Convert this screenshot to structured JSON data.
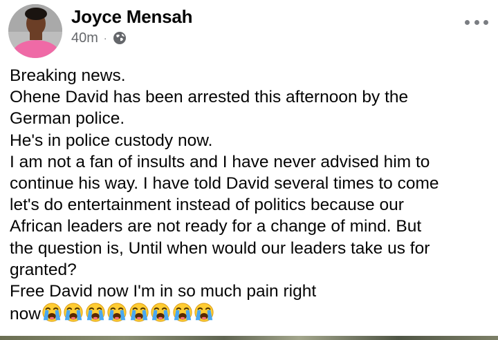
{
  "post": {
    "author": "Joyce Mensah",
    "timestamp": "40m",
    "separator": "·",
    "audience_icon": "globe-icon",
    "menu_icon": "more-options-icon",
    "avatar_icon": "avatar",
    "lines": [
      "Breaking news.",
      "Ohene David has been arrested this afternoon by the",
      "German police.",
      "He's in police custody now.",
      "I am not a fan of insults and I have never advised him to",
      "continue his way. I have told David several times to come",
      "let's do entertainment instead of politics because our",
      "African leaders are not ready for a change of mind. But",
      "the question is, Until when would our leaders take us for",
      "granted?",
      "Free David now I'm in so much pain right",
      "now"
    ],
    "emoji": {
      "icon": "loudly-crying-face-icon",
      "count": 8
    }
  },
  "colors": {
    "text": "#050505",
    "meta": "#65676b",
    "emoji_face": "#ffcc33",
    "emoji_tears": "#4aa8f0"
  }
}
